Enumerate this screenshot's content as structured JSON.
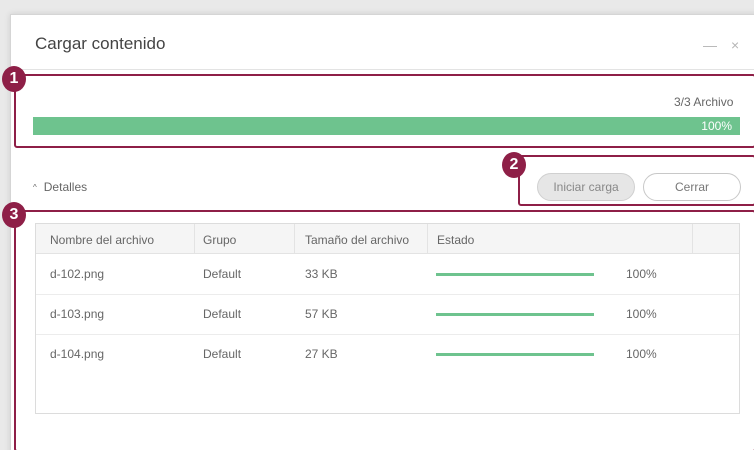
{
  "dialog": {
    "title": "Cargar contenido",
    "minimize_glyph": "—",
    "close_glyph": "×"
  },
  "summary": {
    "file_count": "3/3 Archivo",
    "progress_fraction": 1.0,
    "progress_text": "100%"
  },
  "details_toggle": {
    "caret": "^",
    "label": "Detalles"
  },
  "buttons": {
    "start_upload": "Iniciar carga",
    "close": "Cerrar"
  },
  "table": {
    "headers": [
      "Nombre del archivo",
      "Grupo",
      "Tamaño del archivo",
      "Estado"
    ],
    "rows": [
      {
        "name": "d-102.png",
        "group": "Default",
        "size": "33 KB",
        "progress": 1.0,
        "status": "100%"
      },
      {
        "name": "d-103.png",
        "group": "Default",
        "size": "57 KB",
        "progress": 1.0,
        "status": "100%"
      },
      {
        "name": "d-104.png",
        "group": "Default",
        "size": "27 KB",
        "progress": 1.0,
        "status": "100%"
      }
    ]
  },
  "callouts": [
    "1",
    "2",
    "3"
  ],
  "colors": {
    "progress": "#6ec38e",
    "callout": "#8e1f47"
  }
}
